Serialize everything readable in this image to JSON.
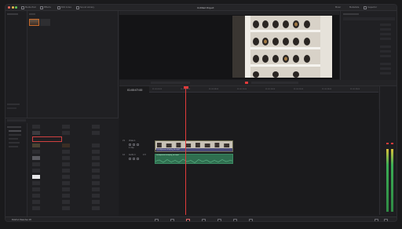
{
  "app": {
    "project_title": "Untitled Project",
    "product_label": "DaVinci Resolve 18"
  },
  "toolbar": {
    "items": [
      "Media Pool",
      "Effects",
      "Edit Index",
      "Sound Library"
    ],
    "right_items": [
      "Mixer",
      "Metadata",
      "Inspector"
    ]
  },
  "timeline": {
    "timecode": "01:00:07:00",
    "ruler_ticks": [
      "01:00:00:00",
      "01:00:04:00",
      "01:00:08:00",
      "01:00:12:00",
      "01:00:16:00",
      "01:00:20:00",
      "01:00:24:00",
      "01:00:28:00"
    ],
    "tracks": [
      {
        "label": "V1",
        "name": "Video 1",
        "clips": "1 Clip"
      },
      {
        "label": "A1",
        "name": "Audio 1",
        "clips": "2.0"
      }
    ],
    "video_clip_name": "headphones-display_4k.mp4",
    "audio_clip_name": "headphones-display_4k.mp4"
  },
  "colors": {
    "accent_red": "#e23b3b",
    "audio_green": "#2f6e4f",
    "clip_name_bar": "#4a4a7a",
    "selected_orange": "#c86a2a"
  },
  "icons": [
    "close-icon",
    "minimize-icon",
    "maximize-icon",
    "media-pool-icon",
    "effects-icon",
    "inspector-icon",
    "cut-page-icon",
    "edit-page-icon",
    "color-page-icon",
    "fairlight-page-icon",
    "deliver-page-icon"
  ]
}
